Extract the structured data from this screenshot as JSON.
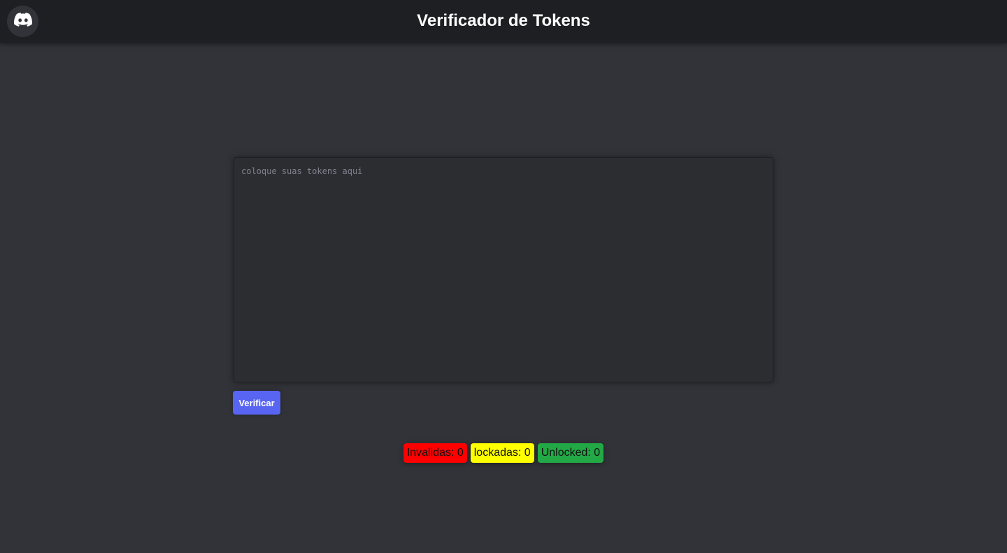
{
  "header": {
    "title": "Verificador de Tokens",
    "logo_icon": "discord-icon"
  },
  "main": {
    "textarea_placeholder": "coloque suas tokens aqui",
    "textarea_value": "",
    "verify_label": "Verificar"
  },
  "counters": [
    {
      "label": "Invalidas: 0",
      "color": "#ff0000"
    },
    {
      "label": "lockadas: 0",
      "color": "#ffff00"
    },
    {
      "label": "Unlocked: 0",
      "color": "#23a846"
    }
  ],
  "colors": {
    "background": "#313338",
    "header": "#1e1f22",
    "accent": "#5865f2"
  }
}
